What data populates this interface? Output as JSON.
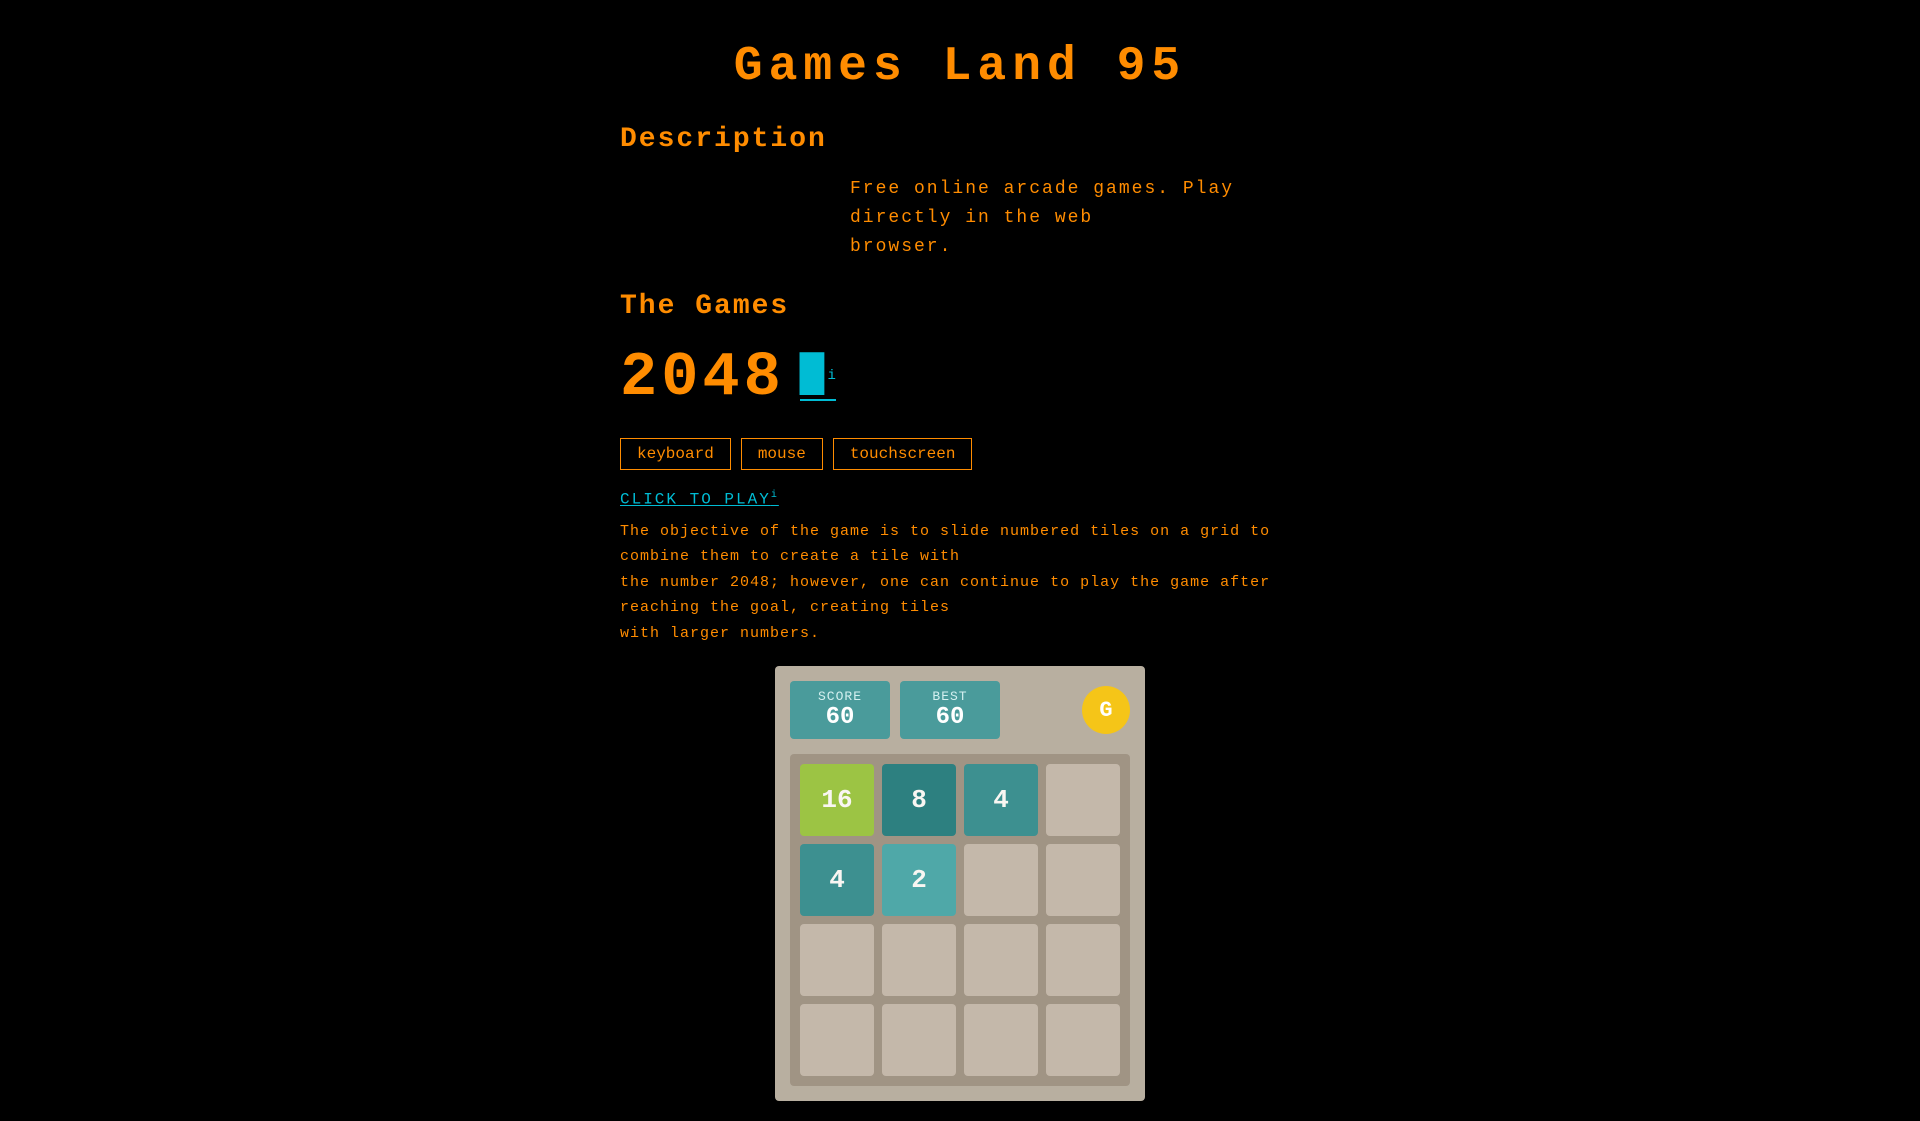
{
  "header": {
    "title": "Games  Land  95"
  },
  "description": {
    "heading": "Description",
    "text_line1": "Free online arcade games. Play directly in the web",
    "text_line2": "browser."
  },
  "games_section": {
    "heading": "The Games",
    "game": {
      "title": "2048",
      "icon_label": "⬛",
      "icon_sup": "i",
      "input_methods": [
        "keyboard",
        "mouse",
        "touchscreen"
      ],
      "click_to_play": "CLICK TO PLAY",
      "click_sup": "i",
      "description_line1": "The objective of the game is to slide numbered tiles on a grid to combine them to create a tile with",
      "description_line2": "the number 2048; however, one can continue to play the game after reaching the goal, creating tiles",
      "description_line3": "with larger numbers.",
      "preview": {
        "score_label": "SCORE",
        "score_value": "60",
        "best_label": "BEST",
        "best_value": "60",
        "refresh_icon": "G",
        "grid": [
          {
            "value": "16",
            "type": "tile-green-light"
          },
          {
            "value": "8",
            "type": "tile-8"
          },
          {
            "value": "4",
            "type": "tile-4"
          },
          {
            "value": "",
            "type": "tile-empty"
          },
          {
            "value": "4",
            "type": "tile-4"
          },
          {
            "value": "2",
            "type": "tile-2"
          },
          {
            "value": "",
            "type": "tile-empty"
          },
          {
            "value": "",
            "type": "tile-empty"
          },
          {
            "value": "",
            "type": "tile-empty"
          },
          {
            "value": "",
            "type": "tile-empty"
          },
          {
            "value": "",
            "type": "tile-empty"
          },
          {
            "value": "",
            "type": "tile-empty"
          },
          {
            "value": "",
            "type": "tile-empty"
          },
          {
            "value": "",
            "type": "tile-empty"
          },
          {
            "value": "",
            "type": "tile-empty"
          },
          {
            "value": "",
            "type": "tile-empty"
          }
        ]
      }
    }
  }
}
